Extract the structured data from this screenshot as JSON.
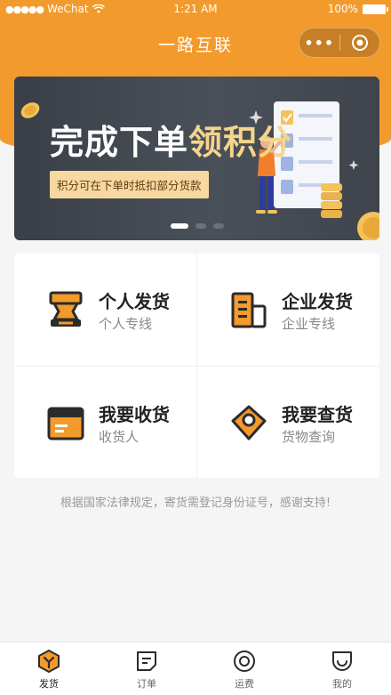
{
  "status_bar": {
    "signal": "●●●●●",
    "carrier": "WeChat",
    "time": "1:21 AM",
    "battery": "100%"
  },
  "nav": {
    "title": "一路互联",
    "more": "•••"
  },
  "banner": {
    "headline_white": "完成下单",
    "headline_highlight": "领积分",
    "subtitle": "积分可在下单时抵扣部分货款",
    "slides": 3,
    "active_slide": 0
  },
  "grid": [
    {
      "title": "个人发货",
      "subtitle": "个人专线",
      "icon": "person-ship-icon"
    },
    {
      "title": "企业发货",
      "subtitle": "企业专线",
      "icon": "building-icon"
    },
    {
      "title": "我要收货",
      "subtitle": "收货人",
      "icon": "box-icon"
    },
    {
      "title": "我要查货",
      "subtitle": "货物查询",
      "icon": "location-search-icon"
    }
  ],
  "notice": "根据国家法律规定，寄货需登记身份证号，感谢支持!",
  "tabbar": [
    {
      "label": "发货",
      "icon": "ship-icon",
      "active": true
    },
    {
      "label": "订单",
      "icon": "order-icon",
      "active": false
    },
    {
      "label": "运费",
      "icon": "freight-icon",
      "active": false
    },
    {
      "label": "我的",
      "icon": "profile-icon",
      "active": false
    }
  ],
  "colors": {
    "accent": "#f39a2c",
    "icon_dark": "#2b2b2b",
    "banner_bg": "#3f444c",
    "highlight": "#f6d48a"
  }
}
